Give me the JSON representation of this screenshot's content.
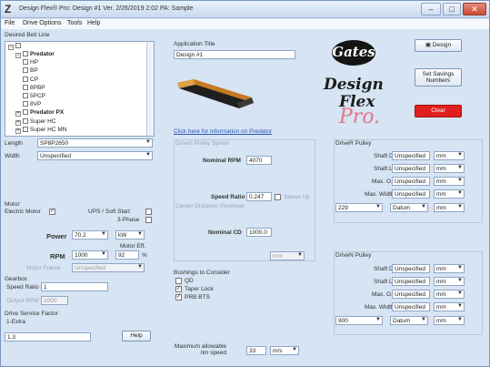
{
  "window": {
    "title": "Design Flex® Pro: Design #1 Ver. 2/26/2019 2:02 PA: Sample",
    "controls": {
      "minimize": "–",
      "maximize": "□",
      "close": "✕"
    }
  },
  "menu": [
    "File",
    "Drive Options",
    "Tools",
    "Help"
  ],
  "left": {
    "belt_group_label": "Desired Belt Line",
    "tree": [
      {
        "text": "Predator",
        "bold": true,
        "indent": 1,
        "pm": "−"
      },
      {
        "text": "HP",
        "indent": 2
      },
      {
        "text": "BP",
        "indent": 2
      },
      {
        "text": "CP",
        "indent": 2
      },
      {
        "text": "8PBP",
        "indent": 2
      },
      {
        "text": "5PCP",
        "indent": 2
      },
      {
        "text": "8VP",
        "indent": 2
      },
      {
        "text": "Predator PX",
        "bold": true,
        "indent": 1,
        "pm": "+"
      },
      {
        "text": "Super HC",
        "indent": 1,
        "pm": "+"
      },
      {
        "text": "Super HC MN",
        "indent": 1,
        "pm": "+"
      }
    ],
    "length_label": "Length",
    "length_value": "SP8P2650",
    "width_label": "Width",
    "width_value": "Unspecified",
    "motor_label": "Motor",
    "electric_motor_label": "Electric Motor",
    "ups_label": "UPS / Soft Start",
    "three_phase_label": "3-Phase",
    "power_label": "Power",
    "power_value": "70.2",
    "power_unit": "kW",
    "motor_eff_label": "Motor Eff.",
    "rpm_label": "RPM",
    "rpm_value": "1000",
    "eff_value": "92",
    "eff_unit": "%",
    "motor_frame_label": "Motor Frame",
    "motor_frame_value": "Unspecified",
    "gearbox_label": "Gearbox",
    "speed_ratio_label": "Speed Ratio",
    "speed_ratio_value": "1",
    "output_rpm_label": "Output RPM",
    "output_rpm_value": "1000",
    "drive_service_label": "Drive Service Factor",
    "extra_label": "1-Extra",
    "service_value": "1.3",
    "help_label": "Help"
  },
  "middle": {
    "app_title_label": "Application Title",
    "app_title_value": "Design #1",
    "click_link": "Click here for information on Predator",
    "speed_group_label": "Driven Pulley Speed",
    "nominal_rpm_label": "Nominal RPM",
    "nominal_rpm_value": "4070",
    "speed_ratio_label": "Speed Ratio",
    "speed_ratio_value": "0.247",
    "speed_up_label": "Speed Up",
    "center_distance_note": "Center Distance (Nominal)",
    "nominal_cd_label": "Nominal CD",
    "nominal_cd_value": "1000.0",
    "cd_unit": "mm",
    "bushing_label": "Bushings to Consider",
    "bushing_items": [
      "QD",
      "Taper Lock",
      "PRB BTS"
    ],
    "max_speed_label": "Maximum allowable\nrim speed",
    "max_speed_value": "33",
    "max_speed_unit": "m/s"
  },
  "right": {
    "design_button": "Design",
    "set_savings_button": "Set Savings\nNumbers",
    "clear_button": "Clear",
    "logo_word_1": "Gates",
    "logo_word_2": "Design",
    "logo_word_3": "Flex",
    "logo_word_4": "Pro.",
    "driver_pulley": {
      "label": "DriveR Pulley",
      "shaft_dia_label": "Shaft Dia.",
      "shaft_dia_value": "Unspecified",
      "shaft_len_label": "Shaft Len.",
      "shaft_len_value": "Unspecified",
      "max_od_label": "Max. O.D.",
      "max_od_value": "Unspecified",
      "max_width_label": "Max. Width",
      "max_width_value": "Unspecified",
      "type_value": "229",
      "mode_value": "Datum",
      "unit": "mm"
    },
    "driven_pulley": {
      "label": "DriveN Pulley",
      "shaft_dia_label": "Shaft Dia.",
      "shaft_dia_value": "Unspecified",
      "shaft_len_label": "Shaft Len.",
      "shaft_len_value": "Unspecified",
      "max_od_label": "Max. O.D.",
      "max_od_value": "Unspecified",
      "max_width_label": "Max. Width",
      "max_width_value": "Unspecified",
      "type_value": "900",
      "mode_value": "Datum",
      "unit": "mm"
    }
  },
  "colors": {
    "accent_red": "#e02020",
    "link": "#2a56b6",
    "panel": "#d6e4f3",
    "logo_pink": "#e6748a"
  }
}
